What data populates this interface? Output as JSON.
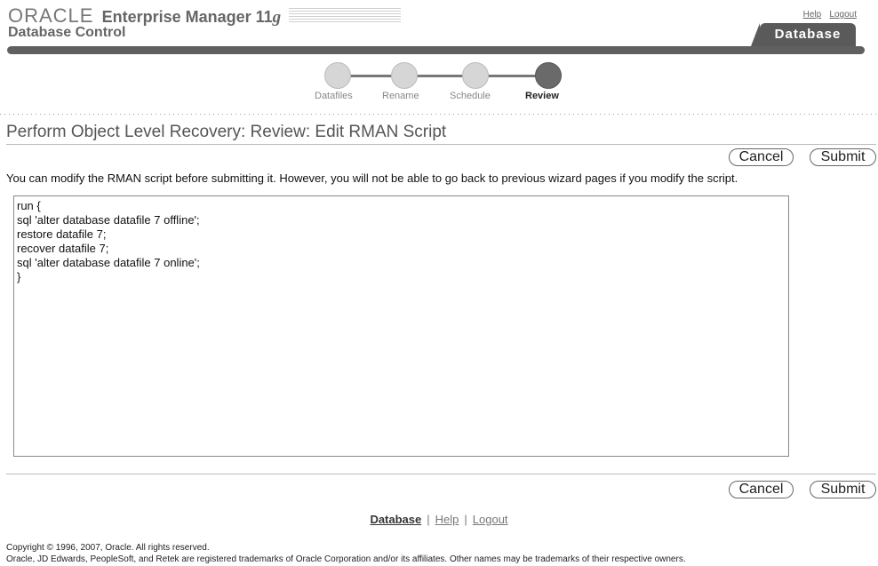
{
  "header": {
    "oracle": "ORACLE",
    "product": "Enterprise Manager 11",
    "version": "g",
    "subtitle": "Database Control",
    "help_link": "Help",
    "logout_link": "Logout",
    "active_tab": "Database"
  },
  "train": {
    "steps": [
      {
        "label": "Datafiles",
        "state": "pending"
      },
      {
        "label": "Rename",
        "state": "pending"
      },
      {
        "label": "Schedule",
        "state": "pending"
      },
      {
        "label": "Review",
        "state": "current"
      }
    ]
  },
  "page": {
    "title": "Perform Object Level Recovery: Review: Edit RMAN Script",
    "instructions": "You can modify the RMAN script before submitting it. However, you will not be able to go back to previous wizard pages if you modify the script.",
    "cancel_label": "Cancel",
    "submit_label": "Submit",
    "script": "run {\nsql 'alter database datafile 7 offline';\nrestore datafile 7;\nrecover datafile 7;\nsql 'alter database datafile 7 online';\n}"
  },
  "footer": {
    "database_link": "Database",
    "help_link": "Help",
    "logout_link": "Logout",
    "separator": "|",
    "copyright": "Copyright © 1996, 2007, Oracle. All rights reserved.",
    "trademark": "Oracle, JD Edwards, PeopleSoft, and Retek are registered trademarks of Oracle Corporation and/or its affiliates. Other names may be trademarks of their respective owners."
  }
}
